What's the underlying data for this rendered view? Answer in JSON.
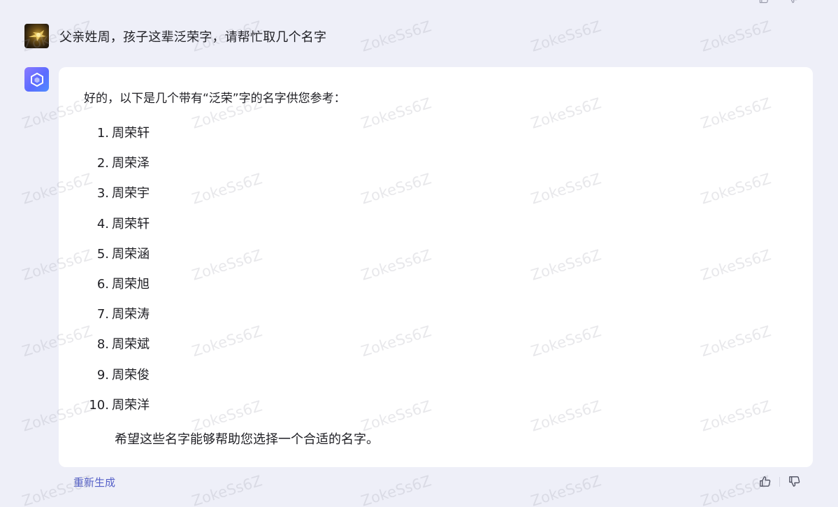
{
  "user": {
    "message": "父亲姓周，孩子这辈泛荣字，请帮忙取几个名字"
  },
  "assistant": {
    "intro": "好的，以下是几个带有“泛荣”字的名字供您参考：",
    "names": [
      {
        "num": "1.",
        "name": "周荣轩"
      },
      {
        "num": "2.",
        "name": "周荣泽"
      },
      {
        "num": "3.",
        "name": "周荣宇"
      },
      {
        "num": "4.",
        "name": "周荣轩"
      },
      {
        "num": "5.",
        "name": "周荣涵"
      },
      {
        "num": "6.",
        "name": "周荣旭"
      },
      {
        "num": "7.",
        "name": "周荣涛"
      },
      {
        "num": "8.",
        "name": "周荣斌"
      },
      {
        "num": "9.",
        "name": "周荣俊"
      },
      {
        "num": "10.",
        "name": "周荣洋"
      }
    ],
    "closing": "希望这些名字能够帮助您选择一个合适的名字。"
  },
  "actions": {
    "regenerate_label": "重新生成"
  },
  "watermark": "ZokeSs6Z",
  "colors": {
    "background": "#eeeff8",
    "card": "#ffffff",
    "accent": "#5560c8",
    "bot_avatar_start": "#8a79ff",
    "bot_avatar_end": "#4f8cff"
  }
}
